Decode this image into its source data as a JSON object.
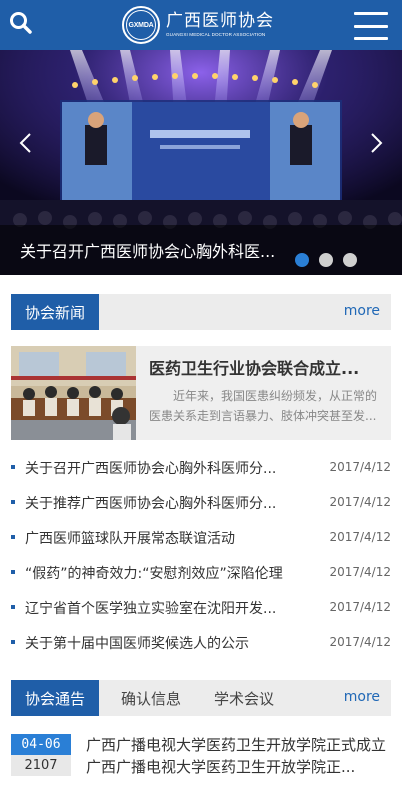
{
  "header": {
    "logo_emblem": "GXMDA",
    "logo_cn": "广西医师协会",
    "logo_en": "GUANGXI MEDICAL DOCTOR ASSOCIATION",
    "search_icon": "search-icon",
    "menu_icon": "hamburger-menu-icon",
    "bg_color": "#1f5ea8"
  },
  "banner": {
    "caption": "关于召开广西医师协会心胸外科医...",
    "slide_count": 3,
    "active_slide": 1
  },
  "news_section": {
    "tab": "协会新闻",
    "more": "more",
    "featured": {
      "title": "医药卫生行业协会联合成立...",
      "summary": "近年来，我国医患纠纷频发，从正常的医患关系走到言语暴力、肢体冲突甚至发..."
    },
    "items": [
      {
        "title": "关于召开广西医师协会心胸外科医师分...",
        "date": "2017/4/12"
      },
      {
        "title": "关于推荐广西医师协会心胸外科医师分...",
        "date": "2017/4/12"
      },
      {
        "title": "广西医师篮球队开展常态联谊活动",
        "date": "2017/4/12"
      },
      {
        "title": "“假药”的神奇效力:“安慰剂效应”深陷伦理",
        "date": "2017/4/12"
      },
      {
        "title": "辽宁省首个医学独立实验室在沈阳开发...",
        "date": "2017/4/12"
      },
      {
        "title": "关于第十届中国医师奖候选人的公示",
        "date": "2017/4/12"
      }
    ]
  },
  "notice_section": {
    "tabs": [
      "协会通告",
      "确认信息",
      "学术会议"
    ],
    "more": "more",
    "items": [
      {
        "month_day": "04-06",
        "year": "2107",
        "text": "广西广播电视大学医药卫生开放学院正式成立广西广播电视大学医药卫生开放学院正..."
      }
    ]
  },
  "colors": {
    "primary": "#1f5ea8",
    "accent": "#2a7fd6",
    "link": "#2068b6"
  }
}
